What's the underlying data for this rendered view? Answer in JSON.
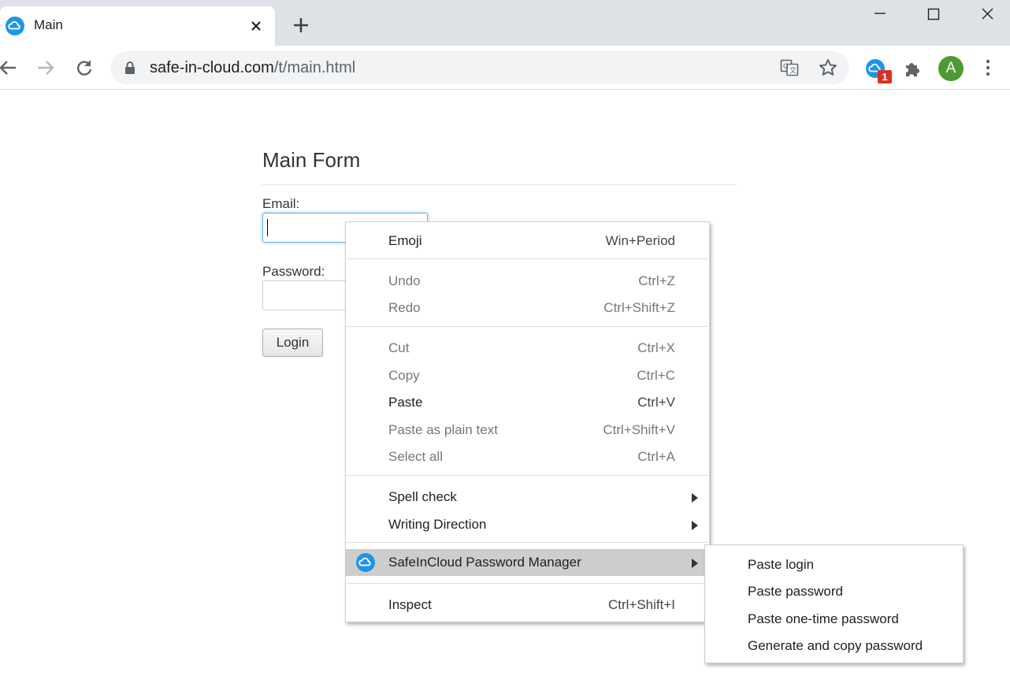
{
  "browser": {
    "tab_title": "Main",
    "url_domain": "safe-in-cloud.com",
    "url_path": "/t/main.html",
    "extension_badge": "1",
    "avatar_letter": "A",
    "avatar_color": "#4e9a32",
    "accent_color": "#1f95e6"
  },
  "page": {
    "title": "Main Form",
    "email_label": "Email:",
    "email_value": "",
    "password_label": "Password:",
    "password_value": "",
    "login_button": "Login"
  },
  "context_menu": {
    "items": [
      {
        "label": "Emoji",
        "shortcut": "Win+Period",
        "enabled": true
      },
      {
        "label": "Undo",
        "shortcut": "Ctrl+Z",
        "enabled": false
      },
      {
        "label": "Redo",
        "shortcut": "Ctrl+Shift+Z",
        "enabled": false
      },
      {
        "label": "Cut",
        "shortcut": "Ctrl+X",
        "enabled": false
      },
      {
        "label": "Copy",
        "shortcut": "Ctrl+C",
        "enabled": false
      },
      {
        "label": "Paste",
        "shortcut": "Ctrl+V",
        "enabled": true
      },
      {
        "label": "Paste as plain text",
        "shortcut": "Ctrl+Shift+V",
        "enabled": false
      },
      {
        "label": "Select all",
        "shortcut": "Ctrl+A",
        "enabled": false
      },
      {
        "label": "Spell check",
        "submenu": true,
        "enabled": true
      },
      {
        "label": "Writing Direction",
        "submenu": true,
        "enabled": true
      },
      {
        "label": "SafeInCloud Password Manager",
        "submenu": true,
        "enabled": true,
        "highlighted": true,
        "icon": "safeincloud-icon"
      },
      {
        "label": "Inspect",
        "shortcut": "Ctrl+Shift+I",
        "enabled": true
      }
    ]
  },
  "submenu": {
    "items": [
      {
        "label": "Paste login"
      },
      {
        "label": "Paste password"
      },
      {
        "label": "Paste one-time password"
      },
      {
        "label": "Generate and copy password"
      }
    ]
  }
}
